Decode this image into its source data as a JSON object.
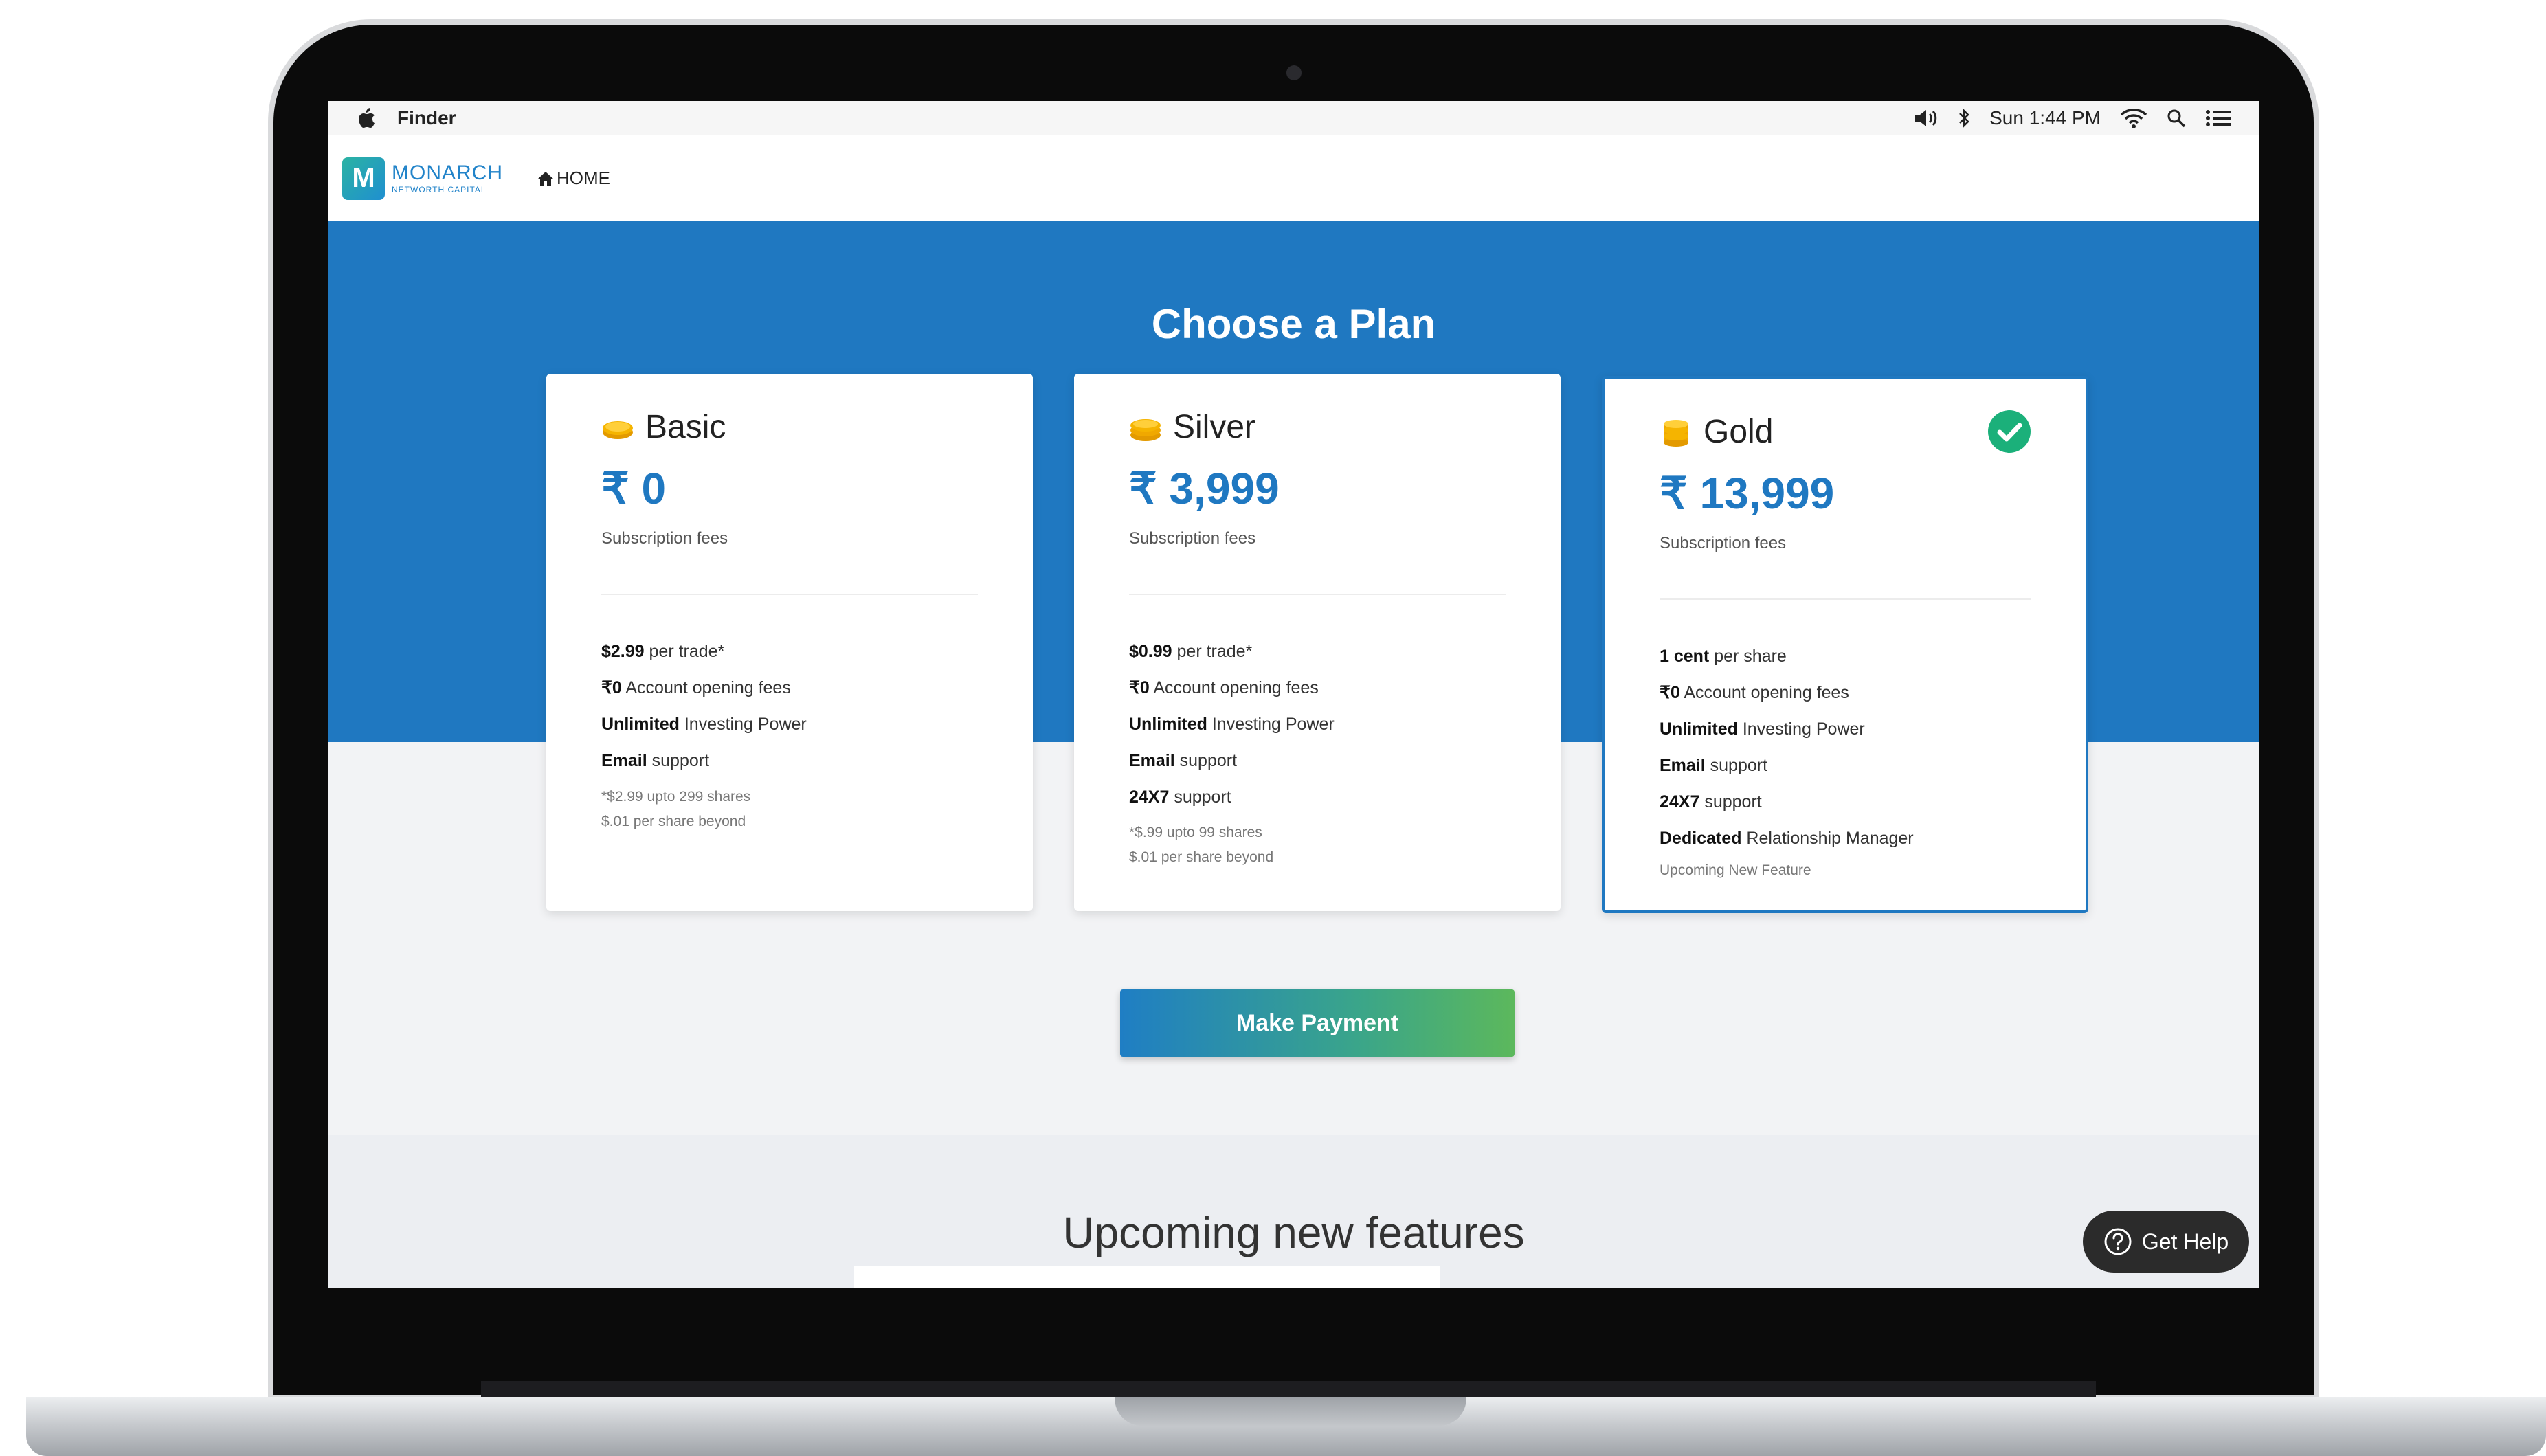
{
  "menubar": {
    "app_name": "Finder",
    "clock": "Sun 1:44 PM"
  },
  "header": {
    "logo_letter": "M",
    "logo_name": "MONARCH",
    "logo_subtitle": "NETWORTH CAPITAL",
    "home_label": "HOME"
  },
  "page": {
    "title": "Choose a Plan",
    "pay_button": "Make Payment",
    "upcoming_title": "Upcoming new features",
    "help_label": "Get Help"
  },
  "plans": [
    {
      "name": "Basic",
      "price": "₹ 0",
      "price_sub": "Subscription fees",
      "selected": false,
      "features": [
        {
          "bold": "$2.99",
          "text": " per trade*"
        },
        {
          "bold": "₹0",
          "text": " Account opening fees"
        },
        {
          "bold": "Unlimited",
          "text": " Investing Power"
        },
        {
          "bold": "Email",
          "text": " support"
        }
      ],
      "notes": [
        "*$2.99 upto 299 shares",
        "$.01 per share beyond"
      ]
    },
    {
      "name": "Silver",
      "price": "₹ 3,999",
      "price_sub": "Subscription fees",
      "selected": false,
      "features": [
        {
          "bold": "$0.99",
          "text": " per trade*"
        },
        {
          "bold": "₹0",
          "text": " Account opening fees"
        },
        {
          "bold": "Unlimited",
          "text": " Investing Power"
        },
        {
          "bold": "Email",
          "text": " support"
        },
        {
          "bold": "24X7",
          "text": " support"
        }
      ],
      "notes": [
        "*$.99 upto 99 shares",
        "$.01 per share beyond"
      ]
    },
    {
      "name": "Gold",
      "price": "₹ 13,999",
      "price_sub": "Subscription fees",
      "selected": true,
      "features": [
        {
          "bold": "1 cent",
          "text": " per share"
        },
        {
          "bold": "₹0",
          "text": " Account opening fees"
        },
        {
          "bold": "Unlimited",
          "text": " Investing Power"
        },
        {
          "bold": "Email",
          "text": " support"
        },
        {
          "bold": "24X7",
          "text": " support"
        },
        {
          "bold": "Dedicated",
          "text": " Relationship Manager"
        }
      ],
      "notes": [
        "Upcoming New Feature"
      ]
    }
  ],
  "colors": {
    "accent_blue": "#1f78c1",
    "check_green": "#1bb07a",
    "coin_gold": "#f5b400"
  }
}
